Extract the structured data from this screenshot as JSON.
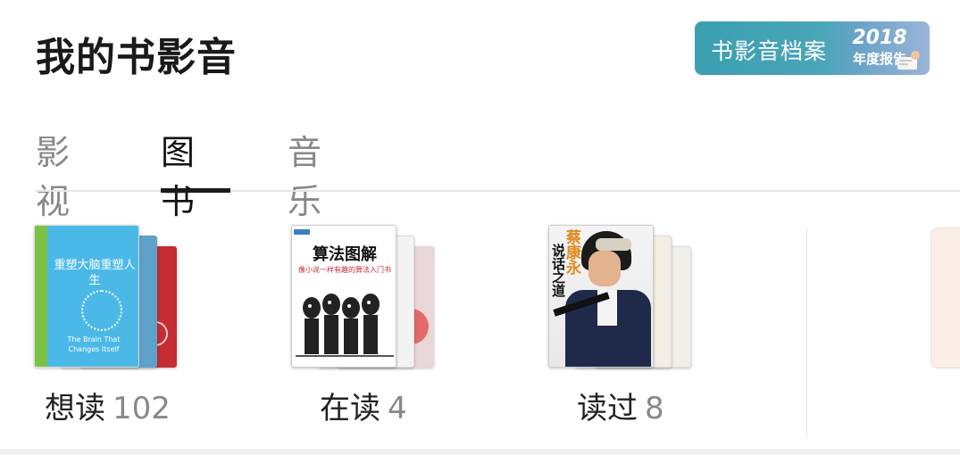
{
  "page": {
    "title": "我的书影音"
  },
  "report_banner": {
    "label": "书影音档案",
    "year": "2018",
    "subtitle": "年度报告"
  },
  "tabs": [
    {
      "label": "影视",
      "active": false
    },
    {
      "label": "图书",
      "active": true
    },
    {
      "label": "音乐",
      "active": false
    }
  ],
  "shelves": [
    {
      "label": "想读",
      "count": "102",
      "cover_title": "重塑大脑重塑人生",
      "cover_subtitle": "The Brain That Changes Itself"
    },
    {
      "label": "在读",
      "count": "4",
      "cover_title": "算法图解",
      "cover_subtitle": "像小说一样有趣的算法入门书"
    },
    {
      "label": "读过",
      "count": "8",
      "cover_title": "蔡康永",
      "cover_subtitle": "说话之道"
    }
  ],
  "colors": {
    "accent": "#1a1a1a",
    "banner": "#3a9fb0",
    "muted": "#888888"
  }
}
